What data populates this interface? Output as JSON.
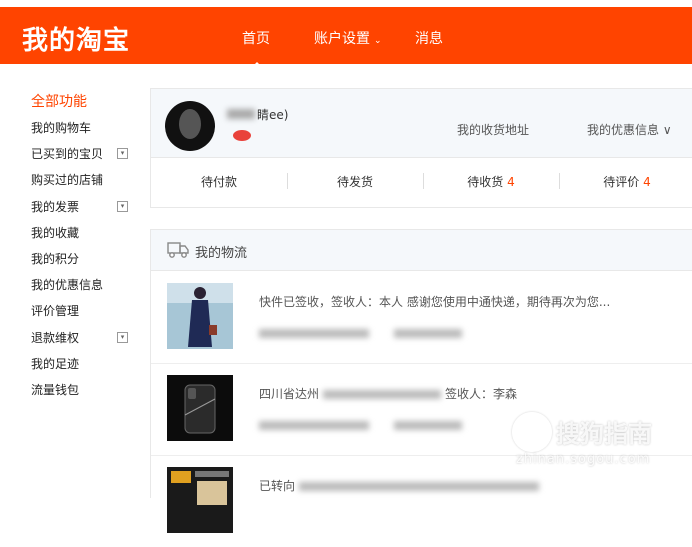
{
  "header": {
    "logo": "我的淘宝",
    "nav": {
      "home": "首页",
      "account": "账户设置",
      "messages": "消息"
    },
    "caret": "⌄"
  },
  "sidebar": {
    "heading": "全部功能",
    "expand_symbol": "▾",
    "items": [
      {
        "label": "我的购物车"
      },
      {
        "label": "已买到的宝贝"
      },
      {
        "label": "购买过的店铺"
      },
      {
        "label": "我的发票"
      },
      {
        "label": "我的收藏"
      },
      {
        "label": "我的积分"
      },
      {
        "label": "我的优惠信息"
      },
      {
        "label": "评价管理"
      },
      {
        "label": "退款维权"
      },
      {
        "label": "我的足迹"
      },
      {
        "label": "流量钱包"
      }
    ]
  },
  "profile": {
    "username_suffix": "睛ee)",
    "address_link": "我的收货地址",
    "coupon_link": "我的优惠信息 ∨",
    "stats": [
      {
        "label": "待付款",
        "count": ""
      },
      {
        "label": "待发货",
        "count": ""
      },
      {
        "label": "待收货",
        "count": "4"
      },
      {
        "label": "待评价",
        "count": "4"
      }
    ]
  },
  "logistics": {
    "title": "我的物流",
    "rows": [
      {
        "prefix": "",
        "status": "快件已签收，签收人：本人 感谢您使用中通快递，期待再次为您...",
        "suffix": ""
      },
      {
        "prefix": "四川省达州",
        "status": "",
        "suffix": "签收人：李森"
      },
      {
        "prefix": "已转向",
        "status": "",
        "suffix": ""
      }
    ]
  },
  "watermark": {
    "text": "搜狗指南",
    "url": "zhinan.sogou.com"
  },
  "colors": {
    "brand": "#ff4400",
    "panel_bg": "#f5f8fb",
    "border": "#e8e8e8"
  }
}
